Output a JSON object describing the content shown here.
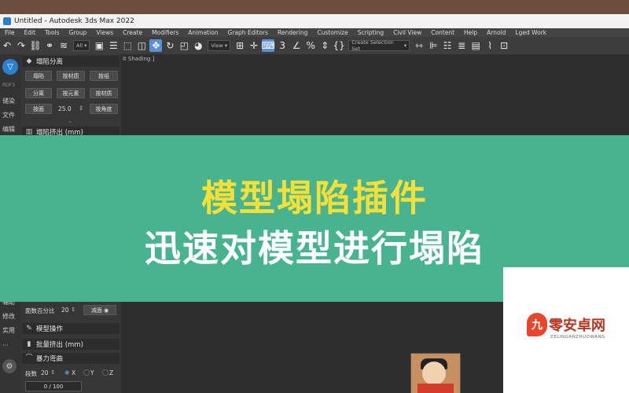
{
  "window": {
    "title": "Untitled - Autodesk 3ds Max 2022"
  },
  "menu": [
    "File",
    "Edit",
    "Tools",
    "Group",
    "Views",
    "Create",
    "Modifiers",
    "Animation",
    "Graph Editors",
    "Rendering",
    "Customize",
    "Scripting",
    "Civil View",
    "Content",
    "Help",
    "Arnold",
    "Lged Work"
  ],
  "toolbar": {
    "filter": "All",
    "view": "View",
    "selection_set": "Create Selection Set"
  },
  "sidebar": {
    "brand": "RDF3",
    "items": [
      "储染",
      "文件",
      "编辑",
      "辅助",
      "修改",
      "实用",
      "···"
    ]
  },
  "panel": {
    "section1_title": "塌陷分离",
    "row1": [
      "塌陷",
      "按材质",
      "按组"
    ],
    "row2": [
      "分离",
      "按元素",
      "按材质"
    ],
    "row3_btn": "按面",
    "row3_value": "25.0",
    "row3_btn2": "按角度",
    "section2_title": "塌陷挤出 (mm)",
    "reduce_label": "面数百分比",
    "reduce_value": "20",
    "reduce_btn": "减面",
    "section3_title": "模型操作",
    "section4_title": "批量挤出 (mm)",
    "section5_title": "暴力弯曲",
    "bend_label": "段数",
    "bend_value": "20",
    "axes": [
      "X",
      "Y",
      "Z"
    ],
    "timeline": "0 / 100"
  },
  "viewport": {
    "label": "lt Shading ]"
  },
  "banner": {
    "line1": "模型塌陷插件",
    "line2": "迅速对模型进行塌陷"
  },
  "watermark": {
    "text": "零安卓网",
    "sub": "ZELINGANZHUOWANG"
  },
  "colors": {
    "banner_bg": "#48b48f",
    "headline": "#f5e03a",
    "accent": "#5b8fd6"
  }
}
